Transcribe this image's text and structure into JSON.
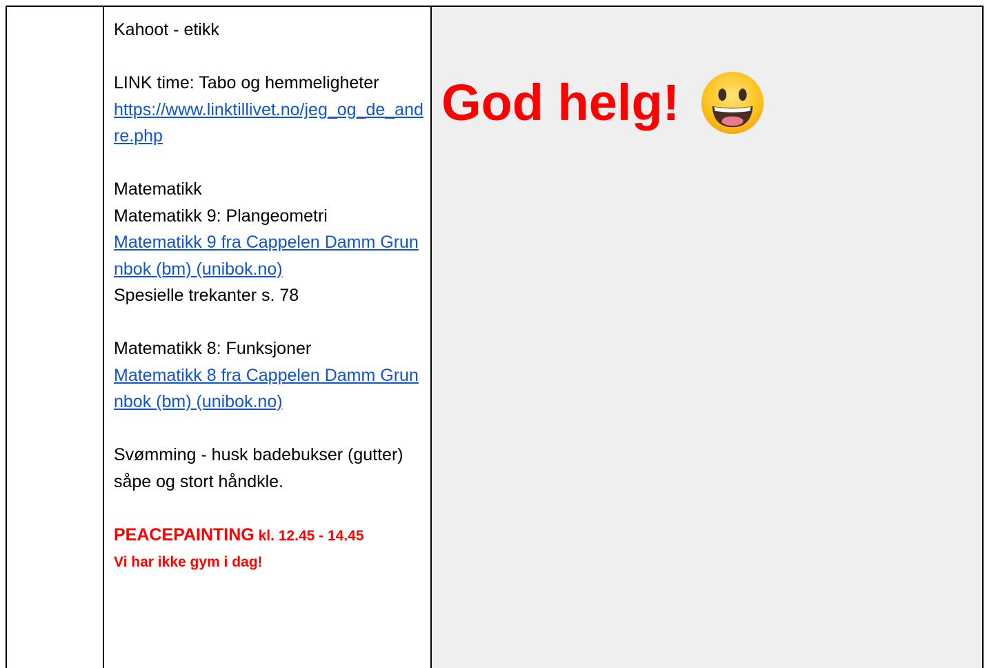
{
  "colors": {
    "link": "#1155cc",
    "highlight_red": "#ff0000",
    "right_cell_bg": "#efefef"
  },
  "content": {
    "line1": "Kahoot - etikk",
    "line2": "LINK time: Tabo og hemmeligheter",
    "link1": "https://www.linktillivet.no/jeg_og_de_andre.php",
    "line3": "Matematikk",
    "line4": "Matematikk 9: Plangeometri",
    "link2": "Matematikk 9 fra Cappelen Damm Grunnbok (bm) (unibok.no)",
    "line5": "Spesielle trekanter s. 78",
    "line6": "Matematikk 8: Funksjoner",
    "link3": "Matematikk 8 fra Cappelen Damm Grunnbok (bm) (unibok.no)",
    "line7": "Svømming - husk badebukser (gutter) såpe og stort håndkle.",
    "peace_title": "PEACEPAINTING",
    "peace_time": " kl. 12.45 - 14.45",
    "no_gym": "Vi har ikke gym i dag!"
  },
  "right": {
    "greeting": "God helg!",
    "emoji_icon": "grinning-face-icon"
  }
}
